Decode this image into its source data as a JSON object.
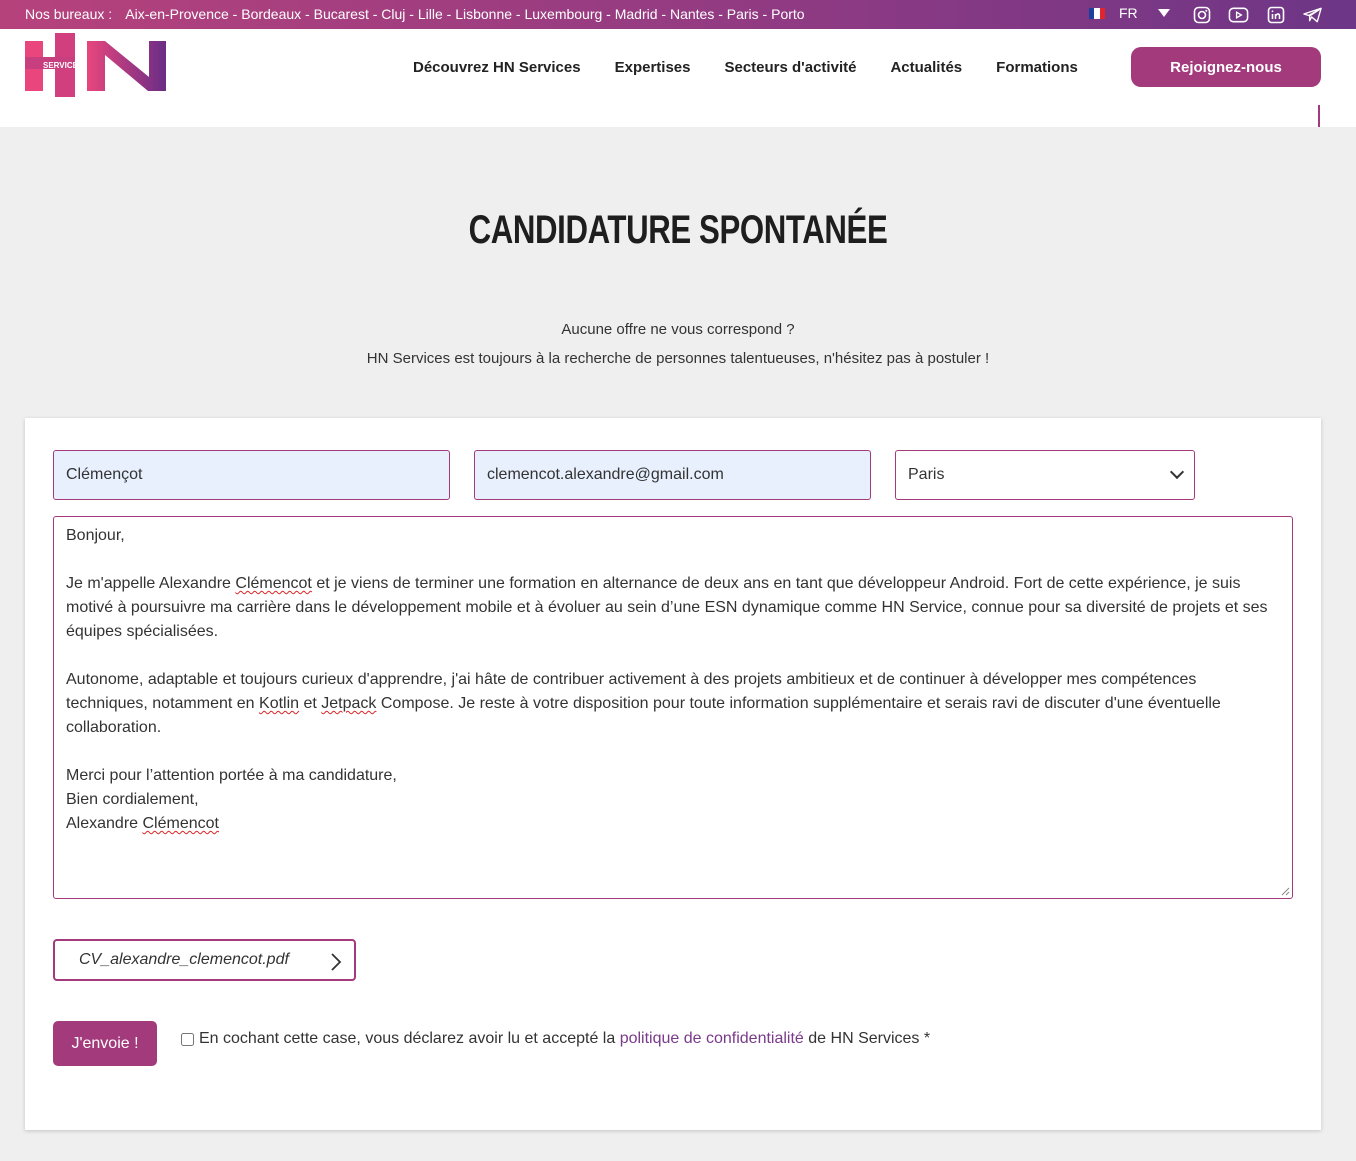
{
  "topbar": {
    "offices_label": "Nos bureaux :",
    "offices": "Aix-en-Provence - Bordeaux - Bucarest - Cluj - Lille - Lisbonne - Luxembourg - Madrid - Nantes - Paris - Porto",
    "language": "FR",
    "socials": [
      "instagram-icon",
      "youtube-icon",
      "linkedin-icon",
      "telegram-icon"
    ]
  },
  "header": {
    "logo_text": "SERVICES",
    "nav": [
      "Découvrez HN Services",
      "Expertises",
      "Secteurs d'activité",
      "Actualités",
      "Formations"
    ],
    "cta": "Rejoignez-nous"
  },
  "page": {
    "title": "CANDIDATURE SPONTANÉE",
    "subtitle_1": "Aucune offre ne vous correspond ?",
    "subtitle_2": "HN Services est toujours à la recherche de personnes talentueuses, n'hésitez pas à postuler !"
  },
  "form": {
    "name_value": "Clémençot",
    "email_value": "clemencot.alexandre@gmail.com",
    "city_value": "Paris",
    "message": {
      "greeting": "Bonjour,",
      "p1_a": "Je m'appelle Alexandre ",
      "p1_name": "Clémencot",
      "p1_b": " et je viens de terminer une formation en alternance de deux ans en tant que développeur Android. Fort de cette expérience, je suis motivé à poursuivre ma carrière dans le développement mobile et à évoluer au sein d’une ESN dynamique comme HN Service, connue pour sa diversité de projets et ses équipes spécialisées.",
      "p2_a": "Autonome, adaptable et toujours curieux d'apprendre, j'ai hâte de contribuer activement à des projets ambitieux et de continuer à développer mes compétences techniques, notamment en ",
      "p2_kotlin": "Kotlin",
      "p2_b": " et ",
      "p2_jetpack": "Jetpack",
      "p2_c": " Compose. Je reste à votre disposition pour toute information supplémentaire et serais ravi de discuter d'une éventuelle collaboration.",
      "closing_1": "Merci pour l’attention portée à ma candidature,",
      "closing_2": "Bien cordialement,",
      "signature_first": "Alexandre ",
      "signature_last": "Clémencot"
    },
    "file_name": "CV_alexandre_clemencot.pdf",
    "submit": "J'envoie !",
    "consent_a": "En cochant cette case, vous déclarez avoir lu et accepté la ",
    "consent_link": "politique de confidentialité",
    "consent_b": " de HN Services *"
  },
  "colors": {
    "brand": "#a23a7c",
    "topbar_start": "#b6427c",
    "topbar_end": "#6d3686",
    "autofill": "#e8f0fe"
  }
}
